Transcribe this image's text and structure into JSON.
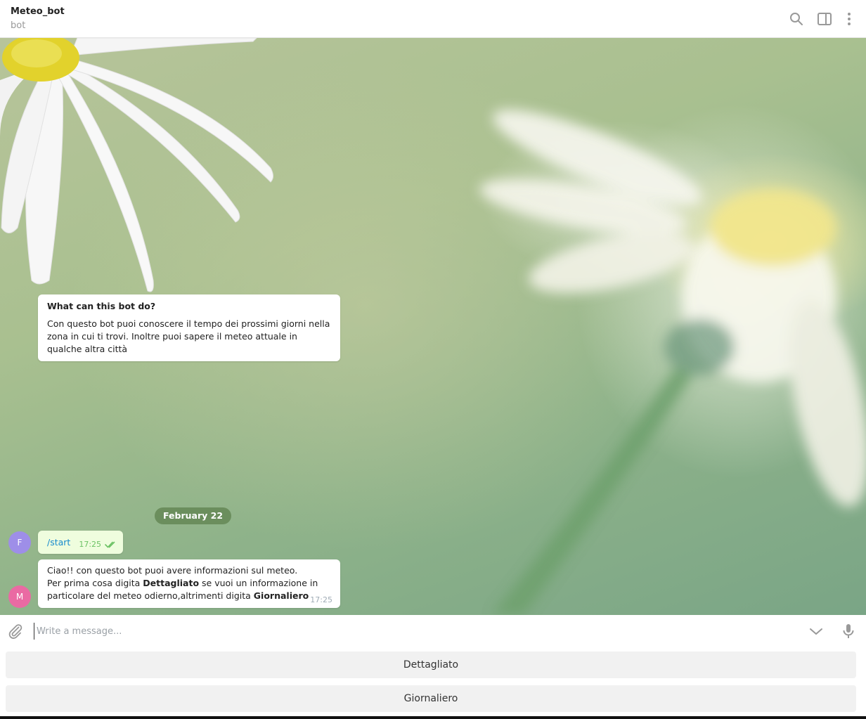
{
  "header": {
    "title": "Meteo_bot",
    "subtitle": "bot",
    "icons": [
      "search-icon",
      "sidebar-toggle-icon",
      "more-vertical-icon"
    ]
  },
  "bot_info": {
    "title": "What can this bot do?",
    "description": "Con questo bot puoi conoscere il tempo dei prossimi giorni nella zona in cui ti trovi. Inoltre puoi sapere il meteo attuale in qualche altra città"
  },
  "date_separator": "February 22",
  "messages": [
    {
      "avatar_letter": "F",
      "avatar_color": "#9e8ee8",
      "text": "/start",
      "time": "17:25",
      "status": "read"
    },
    {
      "avatar_letter": "M",
      "avatar_color": "#ea6aa3",
      "line1": "Ciao!! con questo bot puoi avere informazioni sul meteo.",
      "line2_a": "Per prima cosa digita ",
      "line2_b": "Dettagliato",
      "line2_c": " se vuoi un informazione in",
      "line3_a": "particolare del meteo odierno,altrimenti digita ",
      "line3_b": "Giornaliero",
      "time": "17:25"
    }
  ],
  "composer": {
    "placeholder": "Write a message..."
  },
  "keyboard": {
    "buttons": [
      "Dettagliato",
      "Giornaliero"
    ]
  },
  "colors": {
    "link": "#168acd",
    "outgoing_bubble": "#effdde",
    "read_ticks": "#6cc264",
    "date_pill": "#678a58"
  }
}
